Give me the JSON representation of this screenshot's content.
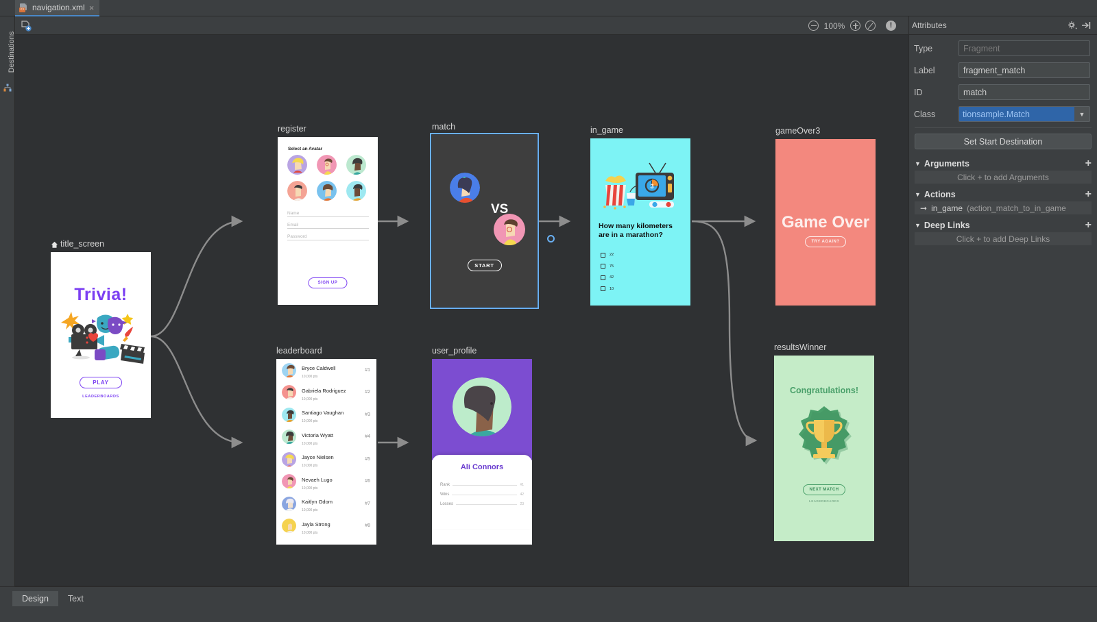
{
  "window": {
    "tab_title": "navigation.xml",
    "tab_close": "×",
    "tab_icon": "navigation-file-icon"
  },
  "left_rail": {
    "label": "Destinations",
    "icon": "destinations-tree-icon"
  },
  "toolbar": {
    "new_destination_icon": "new-destination-icon",
    "zoom_out_icon": "zoom-out-icon",
    "zoom_level": "100%",
    "zoom_in_icon": "zoom-in-icon",
    "zoom_fit_icon": "zoom-to-fit-icon",
    "warning_icon": "warning-issues-icon"
  },
  "attributes": {
    "panel_title": "Attributes",
    "gear_icon": "gear-dropdown-icon",
    "collapse_icon": "collapse-panel-icon",
    "fields": [
      {
        "key": "Type",
        "value": "Fragment",
        "disabled": true,
        "combo": false
      },
      {
        "key": "Label",
        "value": "fragment_match",
        "disabled": false,
        "combo": false
      },
      {
        "key": "ID",
        "value": "match",
        "disabled": false,
        "combo": false
      },
      {
        "key": "Class",
        "value": "tionsample.Match",
        "disabled": false,
        "combo": true
      }
    ],
    "set_start_destination": "Set Start Destination",
    "sections": [
      {
        "title": "Arguments",
        "placeholder": "Click + to add Arguments",
        "plus": "+",
        "triangle": "▼",
        "has_action": false
      },
      {
        "title": "Actions",
        "action_target": "in_game",
        "action_id": "(action_match_to_in_game",
        "plus": "+",
        "triangle": "▼",
        "has_action": true
      },
      {
        "title": "Deep Links",
        "placeholder": "Click + to add Deep Links",
        "plus": "+",
        "triangle": "▼",
        "has_action": false
      }
    ]
  },
  "bottom_tabs": [
    {
      "label": "Design",
      "active": true
    },
    {
      "label": "Text",
      "active": false
    }
  ],
  "destinations": {
    "title_screen": {
      "label": "title_screen",
      "is_start": true,
      "home_icon": "home-start-destination-icon",
      "title": "Trivia!",
      "play_button": "PLAY",
      "leaderboards_link": "LEADERBOARDS"
    },
    "register": {
      "label": "register",
      "heading": "Select an Avatar",
      "fields": [
        "Name",
        "Email",
        "Password"
      ],
      "signup_button": "SIGN UP"
    },
    "match": {
      "label": "match",
      "selected": true,
      "vs_text": "VS",
      "start_button": "START"
    },
    "in_game": {
      "label": "in_game",
      "question": "How many kilometers are in a marathon?",
      "options": [
        "22",
        "75",
        "42",
        "10"
      ]
    },
    "gameOver3": {
      "label": "gameOver3",
      "title": "Game Over",
      "button": "TRY AGAIN?"
    },
    "leaderboard": {
      "label": "leaderboard",
      "rows": [
        {
          "name": "Bryce Caldwell",
          "points": "10,000 pts",
          "rank": "#1"
        },
        {
          "name": "Gabriela Rodriguez",
          "points": "10,000 pts",
          "rank": "#2"
        },
        {
          "name": "Santiago Vaughan",
          "points": "10,000 pts",
          "rank": "#3"
        },
        {
          "name": "Victoria Wyatt",
          "points": "10,000 pts",
          "rank": "#4"
        },
        {
          "name": "Jayce Nielsen",
          "points": "10,000 pts",
          "rank": "#5"
        },
        {
          "name": "Nevaeh Lugo",
          "points": "10,000 pts",
          "rank": "#6"
        },
        {
          "name": "Kaitlyn Odom",
          "points": "10,000 pts",
          "rank": "#7"
        },
        {
          "name": "Jayla Strong",
          "points": "10,000 pts",
          "rank": "#8"
        }
      ]
    },
    "user_profile": {
      "label": "user_profile",
      "name": "Ali Connors",
      "stats": [
        {
          "key": "Rank",
          "value": "#1"
        },
        {
          "key": "Wins",
          "value": "42"
        },
        {
          "key": "Losses",
          "value": "23"
        }
      ]
    },
    "resultsWinner": {
      "label": "resultsWinner",
      "title": "Congratulations!",
      "button": "NEXT MATCH",
      "leaderboards_link": "LEADERBOARDS"
    }
  },
  "colors": {
    "accent_blue": "#6ab0f3",
    "panel_bg": "#3c3f41",
    "canvas_bg": "#2f3133",
    "trivia_purple": "#7b3ff2",
    "in_game_cyan": "#7df3f5",
    "game_over_red": "#f3887e",
    "winner_green": "#c5ecc8",
    "profile_purple": "#7c4dd1",
    "arrow_gray": "#8d8d8d"
  }
}
